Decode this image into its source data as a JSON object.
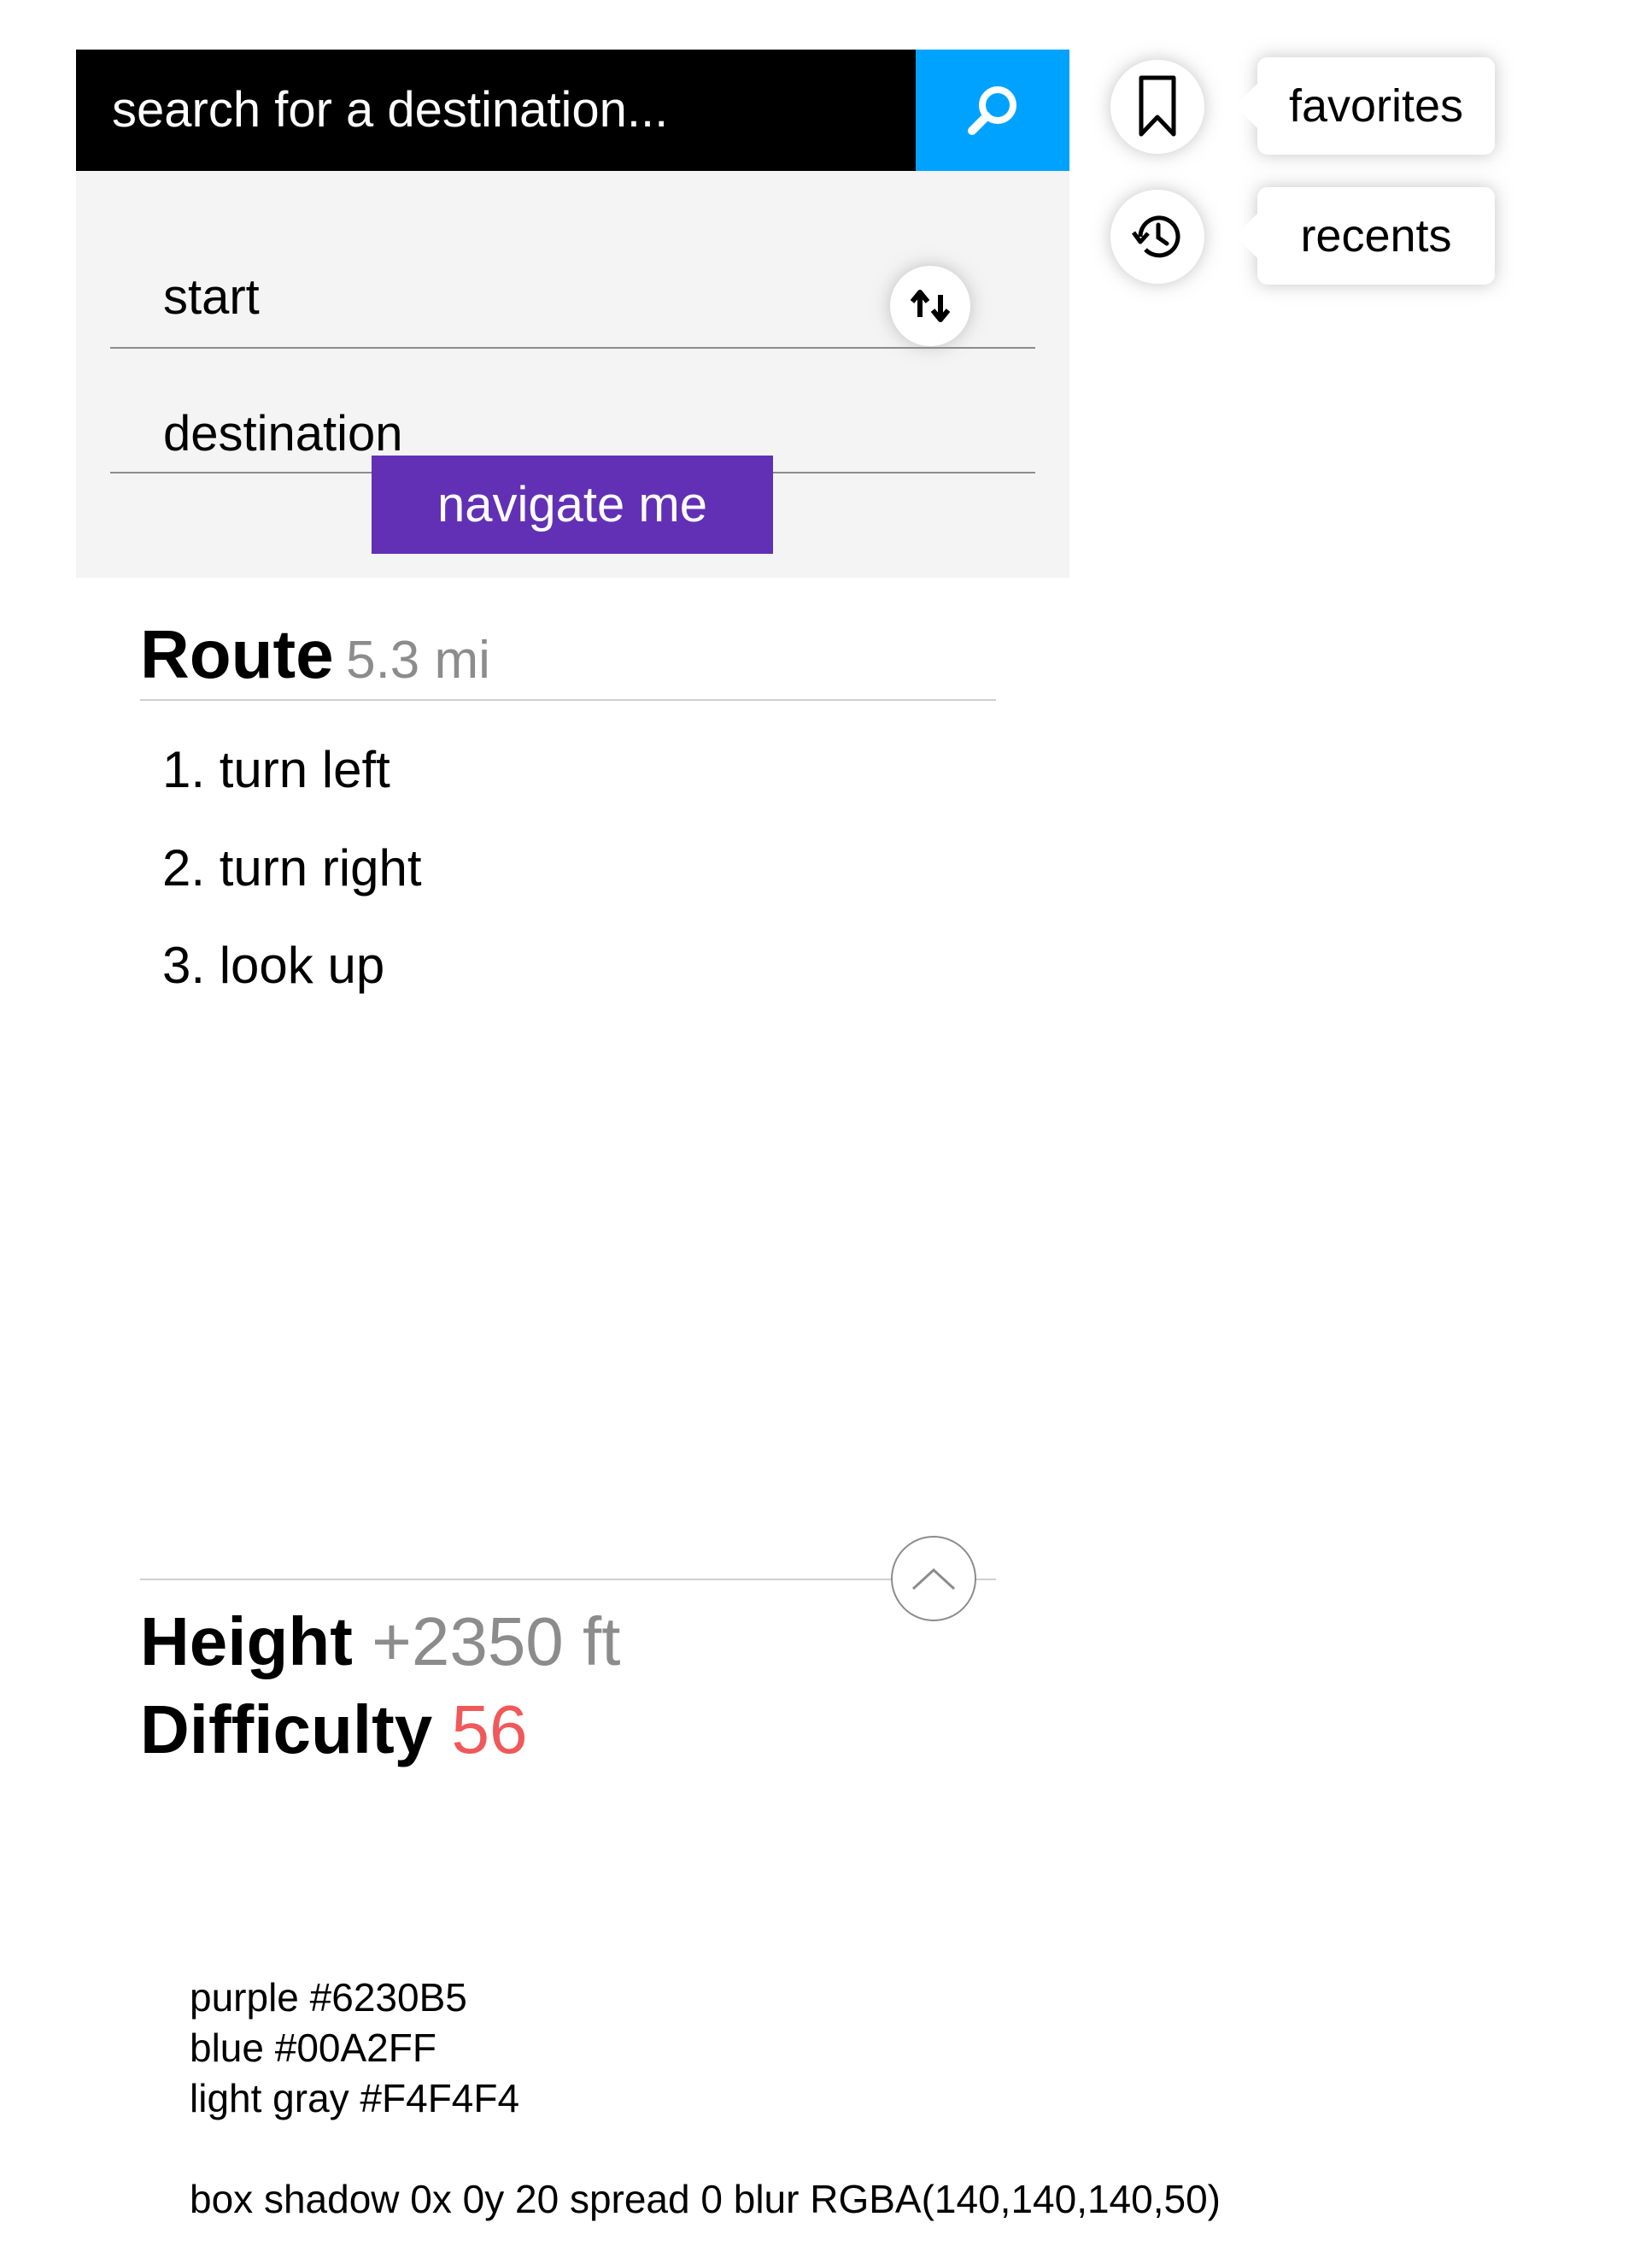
{
  "search": {
    "placeholder": "search for a destination..."
  },
  "form": {
    "start_label": "start",
    "destination_label": "destination",
    "navigate_label": "navigate me"
  },
  "side": {
    "favorites_label": "favorites",
    "recents_label": "recents"
  },
  "route": {
    "title": "Route",
    "distance": "5.3 mi",
    "steps": [
      "1. turn left",
      "2. turn right",
      "3. look up"
    ]
  },
  "stats": {
    "height_label": "Height",
    "height_value": "+2350 ft",
    "difficulty_label": "Difficulty",
    "difficulty_value": "56"
  },
  "notes": {
    "purple": "purple #6230B5",
    "blue": "blue #00A2FF",
    "light_gray": "light gray #F4F4F4",
    "shadow": "box shadow 0x 0y 20 spread 0 blur RGBA(140,140,140,50)"
  },
  "colors": {
    "purple": "#6230B5",
    "blue": "#00A2FF",
    "light_gray": "#F4F4F4",
    "difficulty_red": "#F0585A"
  },
  "icons": [
    "search-icon",
    "swap-icon",
    "bookmark-icon",
    "history-icon",
    "chevron-up-icon"
  ]
}
